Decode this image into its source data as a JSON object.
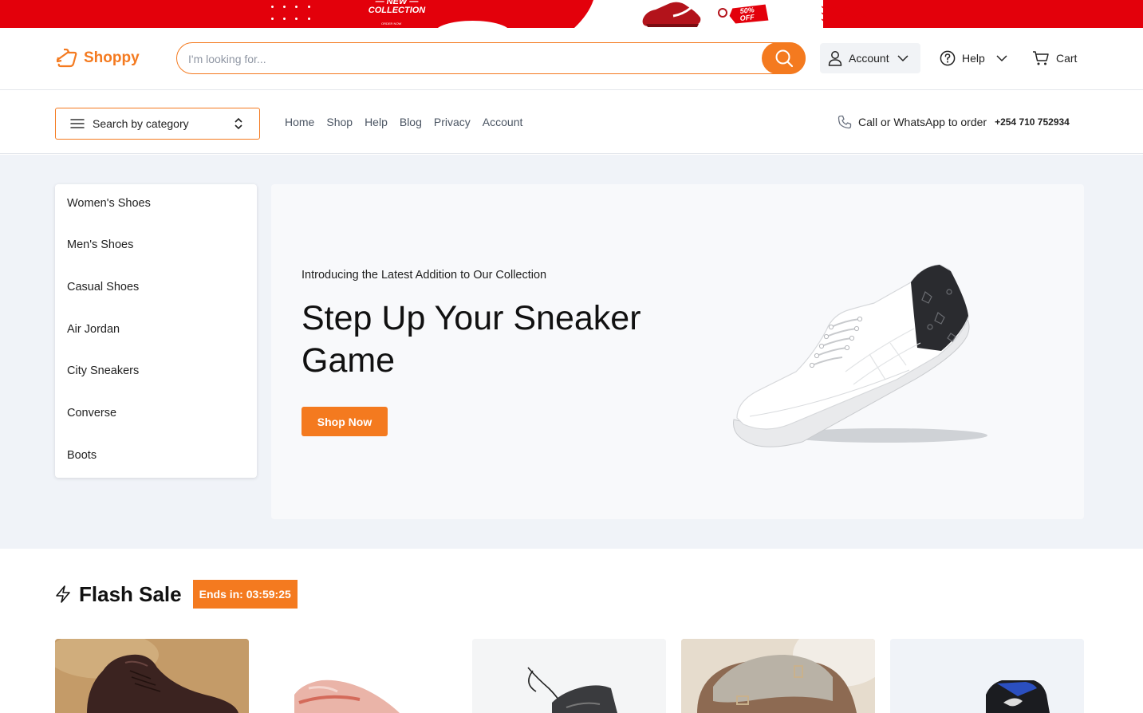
{
  "promo": {
    "new_label": "— NEW —",
    "collection_label": "COLLECTION",
    "order_now": "ORDER NOW",
    "discount_top": "50%",
    "discount_bottom": "OFF"
  },
  "header": {
    "logo_text": "Shoppy",
    "search_placeholder": "I'm looking for...",
    "account_label": "Account",
    "help_label": "Help",
    "cart_label": "Cart"
  },
  "nav": {
    "category_select": "Search by category",
    "links": [
      "Home",
      "Shop",
      "Help",
      "Blog",
      "Privacy",
      "Account"
    ],
    "contact_text": "Call or WhatsApp to order",
    "phone_number": "+254 710 752934"
  },
  "categories": [
    "Women's Shoes",
    "Men's Shoes",
    "Casual Shoes",
    "Air Jordan",
    "City Sneakers",
    "Converse",
    "Boots"
  ],
  "hero": {
    "intro": "Introducing the Latest Addition to Our Collection",
    "headline": "Step Up Your Sneaker Game",
    "cta": "Shop Now"
  },
  "flash_sale": {
    "title": "Flash Sale",
    "timer": "Ends in: 03:59:25"
  },
  "colors": {
    "accent": "#f47a1f",
    "promo_red": "#e3000b",
    "hero_bg": "#f0f3f8"
  }
}
